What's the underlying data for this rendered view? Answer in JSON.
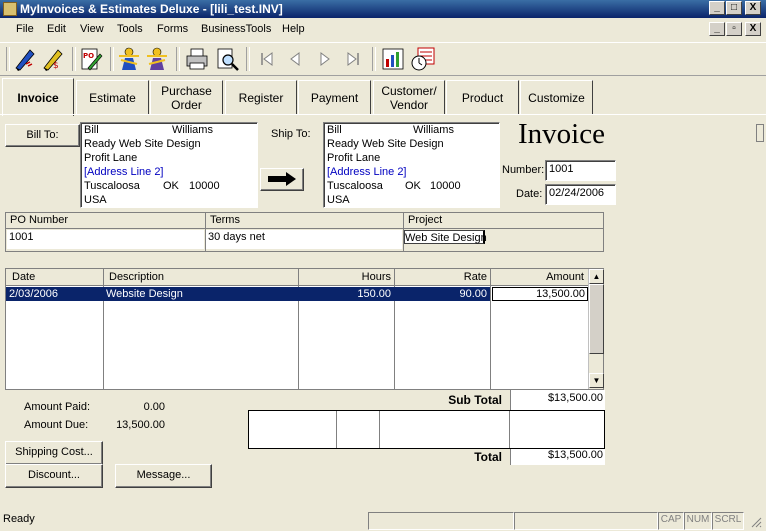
{
  "window": {
    "title": "MyInvoices & Estimates Deluxe - [lili_test.INV]",
    "buttons": [
      "_",
      "□",
      "X"
    ]
  },
  "menu": {
    "items": [
      "File",
      "Edit",
      "View",
      "Tools",
      "Forms",
      "BusinessTools",
      "Help"
    ]
  },
  "toolbar": {
    "icons": [
      "new-invoice-icon",
      "edit-icon",
      "purchase-order-icon",
      "customers-icon",
      "vendors-icon",
      "print-icon",
      "print-preview-icon",
      "first-record-icon",
      "previous-record-icon",
      "next-record-icon",
      "last-record-icon",
      "reports-icon",
      "calculator-clock-icon"
    ]
  },
  "tabs": [
    {
      "label": "Invoice",
      "active": true
    },
    {
      "label": "Estimate"
    },
    {
      "label": "Purchase\nOrder"
    },
    {
      "label": "Register"
    },
    {
      "label": "Payment"
    },
    {
      "label": "Customer/\nVendor"
    },
    {
      "label": "Product"
    },
    {
      "label": "Customize"
    }
  ],
  "bill_to": {
    "button_label": "Bill To:",
    "first_name": "Bill",
    "last_name": "Williams",
    "company": "Ready Web Site Design",
    "address1": "Profit Lane",
    "address2": "[Address Line 2]",
    "city": "Tuscaloosa",
    "state": "OK",
    "zip": "10000",
    "country": "USA"
  },
  "ship_to": {
    "label": "Ship To:",
    "first_name": "Bill",
    "last_name": "Williams",
    "company": "Ready Web Site Design",
    "address1": "Profit Lane",
    "address2": "[Address Line 2]",
    "city": "Tuscaloosa",
    "state": "OK",
    "zip": "10000",
    "country": "USA"
  },
  "invoice": {
    "heading": "Invoice",
    "number_label": "Number:",
    "number": "1001",
    "date_label": "Date:",
    "date": "02/24/2006"
  },
  "order_info": {
    "headers": [
      "PO Number",
      "Terms",
      "Project"
    ],
    "values": [
      "1001",
      "30 days net",
      "Web Site Design"
    ]
  },
  "items": {
    "headers": [
      "Date",
      "Description",
      "Hours",
      "Rate",
      "Amount"
    ],
    "rows": [
      {
        "date": "2/03/2006",
        "description": "Website Design",
        "hours": "150.00",
        "rate": "90.00",
        "amount": "13,500.00"
      }
    ]
  },
  "payment": {
    "amount_paid_label": "Amount Paid:",
    "amount_paid": "0.00",
    "amount_due_label": "Amount Due:",
    "amount_due": "13,500.00"
  },
  "buttons": {
    "shipping": "Shipping Cost...",
    "discount": "Discount...",
    "message": "Message..."
  },
  "totals": {
    "subtotal_label": "Sub Total",
    "subtotal": "$13,500.00",
    "total_label": "Total",
    "total": "$13,500.00"
  },
  "status": {
    "text": "Ready",
    "indicators": [
      "CAP",
      "NUM",
      "SCRL"
    ]
  }
}
